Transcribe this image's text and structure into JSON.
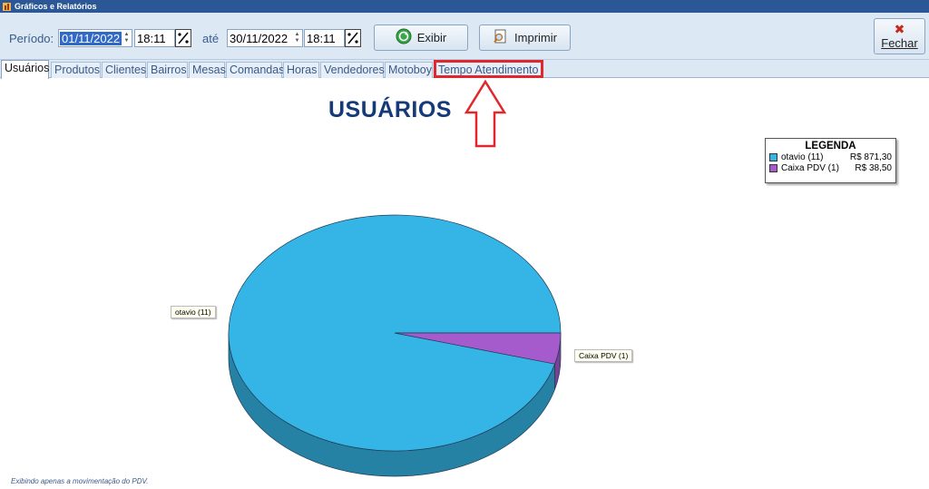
{
  "window": {
    "title": "Gráficos e Relatórios"
  },
  "filters": {
    "period_label": "Período:",
    "start_date": "01/11/2022",
    "start_time": "18:11",
    "until_label": "até",
    "end_date": "30/11/2022",
    "end_time": "18:11"
  },
  "buttons": {
    "show": "Exibir",
    "print": "Imprimir",
    "close": "Fechar"
  },
  "tabs": [
    "Usuários",
    "Produtos",
    "Clientes",
    "Bairros",
    "Mesas",
    "Comandas",
    "Horas",
    "Vendedores",
    "Motoboy",
    "Tempo Atendimento"
  ],
  "active_tab": "Usuários",
  "highlighted_tab": "Tempo Atendimento",
  "content": {
    "heading": "USUÁRIOS",
    "footer_note": "Exibindo apenas a movimentação do PDV."
  },
  "legend": {
    "title": "LEGENDA",
    "items": [
      {
        "name": "otavio (11)",
        "value": "R$ 871,30",
        "color": "#35b5e5"
      },
      {
        "name": "Caixa PDV (1)",
        "value": "R$ 38,50",
        "color": "#a65bcd"
      }
    ]
  },
  "chart_data": {
    "type": "pie",
    "title": "USUÁRIOS",
    "slices": [
      {
        "label": "otavio (11)",
        "value": 871.3,
        "color": "#35b5e5"
      },
      {
        "label": "Caixa PDV (1)",
        "value": 38.5,
        "color": "#a65bcd"
      }
    ]
  },
  "colors": {
    "accent": "#153a78",
    "highlight": "#e1262c"
  }
}
